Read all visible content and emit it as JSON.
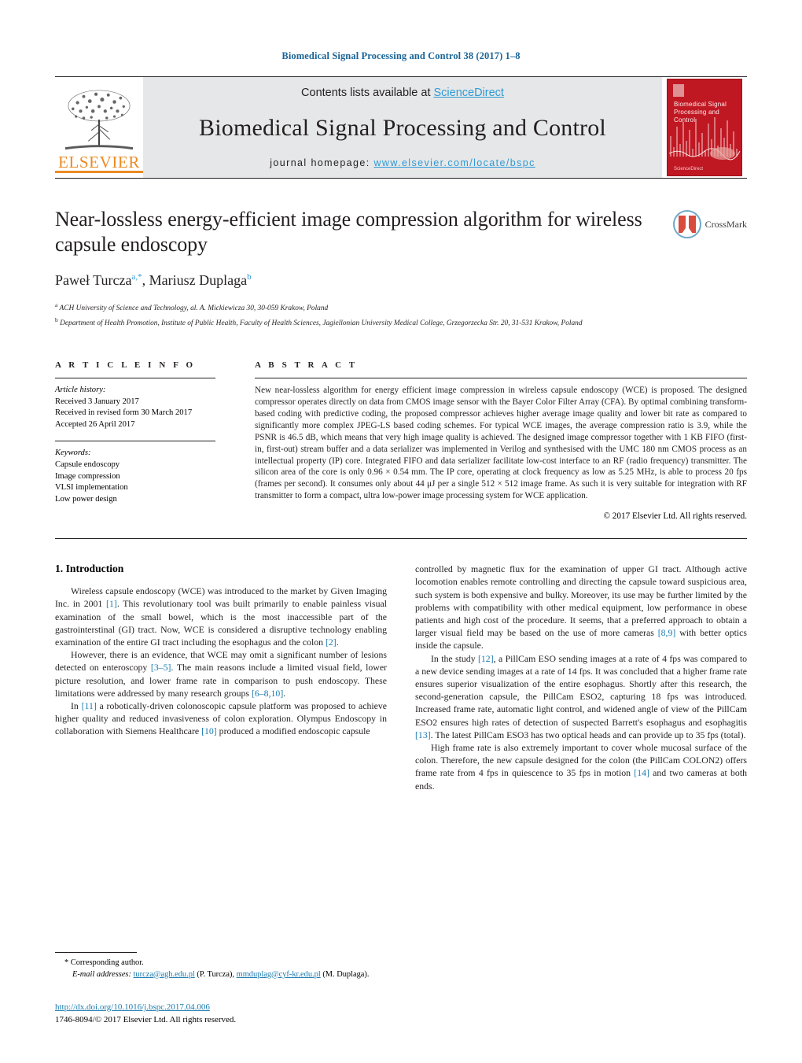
{
  "running_head": "Biomedical Signal Processing and Control 38 (2017) 1–8",
  "masthead": {
    "publisher_name": "ELSEVIER",
    "contents_prefix": "Contents lists available at ",
    "contents_link": "ScienceDirect",
    "journal_title": "Biomedical Signal Processing and Control",
    "homepage_prefix": "journal homepage: ",
    "homepage_url": "www.elsevier.com/locate/bspc",
    "cover_title": "Biomedical Signal Processing and Control",
    "cover_footer": "ScienceDirect"
  },
  "article": {
    "title": "Near-lossless energy-efficient image compression algorithm for wireless capsule endoscopy",
    "authors_html": "Paweł Turcza, Mariusz Duplaga",
    "author1": "Paweł Turcza",
    "author1_sup": "a,*",
    "author2": "Mariusz Duplaga",
    "author2_sup": "b",
    "affiliation_a": "ACH University of Science and Technology, al. A. Mickiewicza 30, 30-059 Krakow, Poland",
    "affiliation_b": "Department of Health Promotion, Institute of Public Health, Faculty of Health Sciences, Jagiellonian University Medical College, Grzegorzecka Str. 20, 31-531 Krakow, Poland",
    "crossmark_label": "CrossMark"
  },
  "info": {
    "heading": "A R T I C L E   I N F O",
    "history_label": "Article history:",
    "history": [
      "Received 3 January 2017",
      "Received in revised form 30 March 2017",
      "Accepted 26 April 2017"
    ],
    "keywords_label": "Keywords:",
    "keywords": [
      "Capsule endoscopy",
      "Image compression",
      "VLSI implementation",
      "Low power design"
    ]
  },
  "abstract": {
    "heading": "A B S T R A C T",
    "text": "New near-lossless algorithm for energy efficient image compression in wireless capsule endoscopy (WCE) is proposed. The designed compressor operates directly on data from CMOS image sensor with the Bayer Color Filter Array (CFA). By optimal combining transform-based coding with predictive coding, the proposed compressor achieves higher average image quality and lower bit rate as compared to significantly more complex JPEG-LS based coding schemes. For typical WCE images, the average compression ratio is 3.9, while the PSNR is 46.5 dB, which means that very high image quality is achieved. The designed image compressor together with 1 KB FIFO (first-in, first-out) stream buffer and a data serializer was implemented in Verilog and synthesised with the UMC 180 nm CMOS process as an intellectual property (IP) core. Integrated FIFO and data serializer facilitate low-cost interface to an RF (radio frequency) transmitter. The silicon area of the core is only 0.96 × 0.54 mm. The IP core, operating at clock frequency as low as 5.25 MHz, is able to process 20 fps (frames per second). It consumes only about 44 μJ per a single 512 × 512 image frame. As such it is very suitable for integration with RF transmitter to form a compact, ultra low-power image processing system for WCE application.",
    "copyright": "© 2017 Elsevier Ltd. All rights reserved."
  },
  "body": {
    "section_number_title": "1.  Introduction",
    "left_paragraphs": [
      "Wireless capsule endoscopy (WCE) was introduced to the market by Given Imaging Inc. in 2001 [1]. This revolutionary tool was built primarily to enable painless visual examination of the small bowel, which is the most inaccessible part of the gastrointerstinal (GI) tract. Now, WCE is considered a disruptive technology enabling examination of the entire GI tract including the esophagus and the colon [2].",
      "However, there is an evidence, that WCE may omit a significant number of lesions detected on enteroscopy [3–5]. The main reasons include a limited visual field, lower picture resolution, and lower frame rate in comparison to push endoscopy. These limitations were addressed by many research groups [6–8,10].",
      "In [11] a robotically-driven colonoscopic capsule platform was proposed to achieve higher quality and reduced invasiveness of colon exploration. Olympus Endoscopy in collaboration with Siemens Healthcare [10] produced a modified endoscopic capsule"
    ],
    "right_paragraphs": [
      "controlled by magnetic flux for the examination of upper GI tract. Although active locomotion enables remote controlling and directing the capsule toward suspicious area, such system is both expensive and bulky. Moreover, its use may be further limited by the problems with compatibility with other medical equipment, low performance in obese patients and high cost of the procedure. It seems, that a preferred approach to obtain a larger visual field may be based on the use of more cameras [8,9] with better optics inside the capsule.",
      "In the study [12], a PillCam ESO sending images at a rate of 4 fps was compared to a new device sending images at a rate of 14 fps. It was concluded that a higher frame rate ensures superior visualization of the entire esophagus. Shortly after this research, the second-generation capsule, the PillCam ESO2, capturing 18 fps was introduced. Increased frame rate, automatic light control, and widened angle of view of the PillCam ESO2 ensures high rates of detection of suspected Barrett's esophagus and esophagitis [13]. The latest PillCam ESO3 has two optical heads and can provide up to 35 fps (total).",
      "High frame rate is also extremely important to cover whole mucosal surface of the colon. Therefore, the new capsule designed for the colon (the PillCam COLON2) offers frame rate from 4 fps in quiescence to 35 fps in motion [14] and two cameras at both ends."
    ]
  },
  "footnote": {
    "corresponding": "* Corresponding author.",
    "email_label": "E-mail addresses:",
    "email1": "turcza@agh.edu.pl",
    "email1_owner": " (P. Turcza), ",
    "email2": "mmduplag@cyf-kr.edu.pl",
    "email2_owner": "(M. Duplaga)."
  },
  "doi": {
    "url": "http://dx.doi.org/10.1016/j.bspc.2017.04.006",
    "issn_line": "1746-8094/© 2017 Elsevier Ltd. All rights reserved."
  },
  "colors": {
    "link_blue": "#1a7ab0",
    "sciencedirect_blue": "#2e9bd6",
    "elsevier_orange": "#eb8b24",
    "cover_red": "#c01823",
    "text": "#231f20"
  }
}
